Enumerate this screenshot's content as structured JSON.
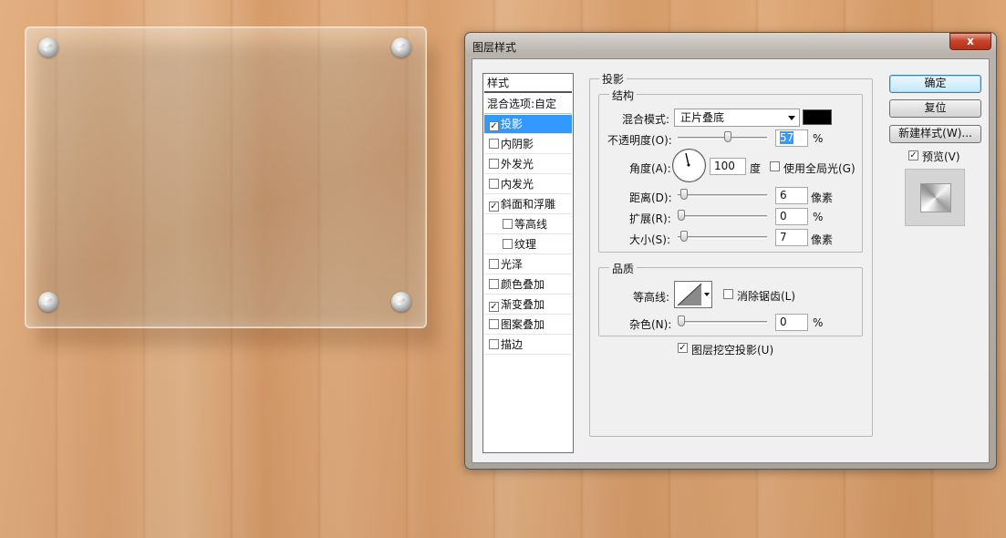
{
  "colors": {
    "selection": "#3399ff",
    "close_button": "#c8442a",
    "shadow_color_swatch": "#000000"
  },
  "dialog": {
    "title": "图层样式",
    "close_label": "x"
  },
  "styles_list": {
    "header": "样式",
    "blend_options": "混合选项:自定",
    "items": [
      {
        "label": "投影",
        "checked": true,
        "selected": true,
        "indent": false
      },
      {
        "label": "内阴影",
        "checked": false,
        "selected": false,
        "indent": false
      },
      {
        "label": "外发光",
        "checked": false,
        "selected": false,
        "indent": false
      },
      {
        "label": "内发光",
        "checked": false,
        "selected": false,
        "indent": false
      },
      {
        "label": "斜面和浮雕",
        "checked": true,
        "selected": false,
        "indent": false
      },
      {
        "label": "等高线",
        "checked": false,
        "selected": false,
        "indent": true
      },
      {
        "label": "纹理",
        "checked": false,
        "selected": false,
        "indent": true
      },
      {
        "label": "光泽",
        "checked": false,
        "selected": false,
        "indent": false
      },
      {
        "label": "颜色叠加",
        "checked": false,
        "selected": false,
        "indent": false
      },
      {
        "label": "渐变叠加",
        "checked": true,
        "selected": false,
        "indent": false
      },
      {
        "label": "图案叠加",
        "checked": false,
        "selected": false,
        "indent": false
      },
      {
        "label": "描边",
        "checked": false,
        "selected": false,
        "indent": false
      }
    ]
  },
  "drop_shadow": {
    "section_title": "投影",
    "structure": {
      "title": "结构",
      "blend_mode_label": "混合模式:",
      "blend_mode_value": "正片叠底",
      "opacity_label": "不透明度(O):",
      "opacity_value": "57",
      "opacity_fraction": 0.57,
      "percent": "%",
      "angle_label": "角度(A):",
      "angle_value": "100",
      "angle_unit": "度",
      "global_light_label": "使用全局光(G)",
      "global_light_checked": false,
      "distance_label": "距离(D):",
      "distance_value": "6",
      "distance_fraction": 0.03,
      "pixel_unit": "像素",
      "spread_label": "扩展(R):",
      "spread_value": "0",
      "spread_fraction": 0.0,
      "size_label": "大小(S):",
      "size_value": "7",
      "size_fraction": 0.03
    },
    "quality": {
      "title": "品质",
      "contour_label": "等高线:",
      "anti_alias_label": "消除锯齿(L)",
      "anti_alias_checked": false,
      "noise_label": "杂色(N):",
      "noise_value": "0",
      "noise_fraction": 0.0,
      "percent": "%"
    },
    "knockout_label": "图层挖空投影(U)",
    "knockout_checked": true
  },
  "buttons": {
    "ok": "确定",
    "reset": "复位",
    "new_style": "新建样式(W)...",
    "preview_label": "预览(V)",
    "preview_checked": true
  }
}
